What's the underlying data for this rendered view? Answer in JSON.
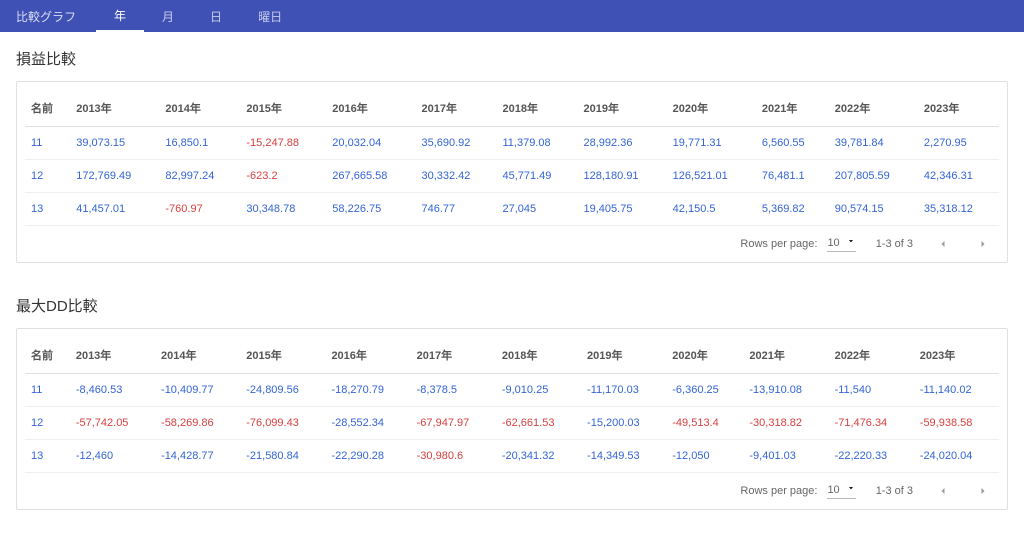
{
  "header": {
    "appTitle": "比較グラフ",
    "tabs": [
      "年",
      "月",
      "日",
      "曜日"
    ],
    "activeTab": 0
  },
  "tables": [
    {
      "title": "損益比較",
      "nameHeader": "名前",
      "years": [
        "2013年",
        "2014年",
        "2015年",
        "2016年",
        "2017年",
        "2018年",
        "2019年",
        "2020年",
        "2021年",
        "2022年",
        "2023年"
      ],
      "rows": [
        {
          "name": "11",
          "cells": [
            {
              "v": "39,073.15",
              "n": false
            },
            {
              "v": "16,850.1",
              "n": false
            },
            {
              "v": "-15,247.88",
              "n": true
            },
            {
              "v": "20,032.04",
              "n": false
            },
            {
              "v": "35,690.92",
              "n": false
            },
            {
              "v": "11,379.08",
              "n": false
            },
            {
              "v": "28,992.36",
              "n": false
            },
            {
              "v": "19,771.31",
              "n": false
            },
            {
              "v": "6,560.55",
              "n": false
            },
            {
              "v": "39,781.84",
              "n": false
            },
            {
              "v": "2,270.95",
              "n": false
            }
          ]
        },
        {
          "name": "12",
          "cells": [
            {
              "v": "172,769.49",
              "n": false
            },
            {
              "v": "82,997.24",
              "n": false
            },
            {
              "v": "-623.2",
              "n": true
            },
            {
              "v": "267,665.58",
              "n": false
            },
            {
              "v": "30,332.42",
              "n": false
            },
            {
              "v": "45,771.49",
              "n": false
            },
            {
              "v": "128,180.91",
              "n": false
            },
            {
              "v": "126,521.01",
              "n": false
            },
            {
              "v": "76,481.1",
              "n": false
            },
            {
              "v": "207,805.59",
              "n": false
            },
            {
              "v": "42,346.31",
              "n": false
            }
          ]
        },
        {
          "name": "13",
          "cells": [
            {
              "v": "41,457.01",
              "n": false
            },
            {
              "v": "-760.97",
              "n": true
            },
            {
              "v": "30,348.78",
              "n": false
            },
            {
              "v": "58,226.75",
              "n": false
            },
            {
              "v": "746.77",
              "n": false
            },
            {
              "v": "27,045",
              "n": false
            },
            {
              "v": "19,405.75",
              "n": false
            },
            {
              "v": "42,150.5",
              "n": false
            },
            {
              "v": "5,369.82",
              "n": false
            },
            {
              "v": "90,574.15",
              "n": false
            },
            {
              "v": "35,318.12",
              "n": false
            }
          ]
        }
      ],
      "pagination": {
        "rowsPerPageLabel": "Rows per page:",
        "rowsPerPageValue": "10",
        "range": "1-3 of 3"
      }
    },
    {
      "title": "最大DD比較",
      "nameHeader": "名前",
      "years": [
        "2013年",
        "2014年",
        "2015年",
        "2016年",
        "2017年",
        "2018年",
        "2019年",
        "2020年",
        "2021年",
        "2022年",
        "2023年"
      ],
      "rows": [
        {
          "name": "11",
          "cells": [
            {
              "v": "-8,460.53",
              "n": false
            },
            {
              "v": "-10,409.77",
              "n": false
            },
            {
              "v": "-24,809.56",
              "n": false
            },
            {
              "v": "-18,270.79",
              "n": false
            },
            {
              "v": "-8,378.5",
              "n": false
            },
            {
              "v": "-9,010.25",
              "n": false
            },
            {
              "v": "-11,170.03",
              "n": false
            },
            {
              "v": "-6,360.25",
              "n": false
            },
            {
              "v": "-13,910.08",
              "n": false
            },
            {
              "v": "-11,540",
              "n": false
            },
            {
              "v": "-11,140.02",
              "n": false
            }
          ]
        },
        {
          "name": "12",
          "cells": [
            {
              "v": "-57,742.05",
              "n": true
            },
            {
              "v": "-58,269.86",
              "n": true
            },
            {
              "v": "-76,099.43",
              "n": true
            },
            {
              "v": "-28,552.34",
              "n": false
            },
            {
              "v": "-67,947.97",
              "n": true
            },
            {
              "v": "-62,661.53",
              "n": true
            },
            {
              "v": "-15,200.03",
              "n": false
            },
            {
              "v": "-49,513.4",
              "n": true
            },
            {
              "v": "-30,318.82",
              "n": true
            },
            {
              "v": "-71,476.34",
              "n": true
            },
            {
              "v": "-59,938.58",
              "n": true
            }
          ]
        },
        {
          "name": "13",
          "cells": [
            {
              "v": "-12,460",
              "n": false
            },
            {
              "v": "-14,428.77",
              "n": false
            },
            {
              "v": "-21,580.84",
              "n": false
            },
            {
              "v": "-22,290.28",
              "n": false
            },
            {
              "v": "-30,980.6",
              "n": true
            },
            {
              "v": "-20,341.32",
              "n": false
            },
            {
              "v": "-14,349.53",
              "n": false
            },
            {
              "v": "-12,050",
              "n": false
            },
            {
              "v": "-9,401.03",
              "n": false
            },
            {
              "v": "-22,220.33",
              "n": false
            },
            {
              "v": "-24,020.04",
              "n": false
            }
          ]
        }
      ],
      "pagination": {
        "rowsPerPageLabel": "Rows per page:",
        "rowsPerPageValue": "10",
        "range": "1-3 of 3"
      }
    }
  ]
}
